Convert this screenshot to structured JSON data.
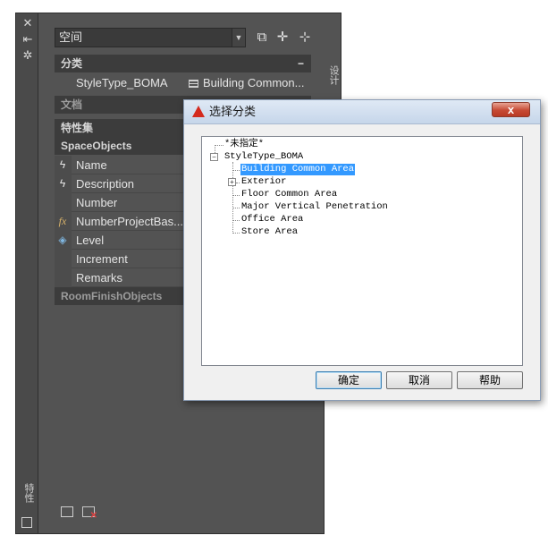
{
  "strip": {
    "label": "特性",
    "buttons": [
      "close-icon",
      "auto-hide-icon",
      "properties-menu-icon"
    ]
  },
  "palette": {
    "right_tab_label": "设计",
    "style_select_value": "空间",
    "sections": {
      "classification": {
        "title": "分类",
        "collapse_glyph": "−",
        "row_label": "StyleType_BOMA",
        "row_value": "Building Common..."
      },
      "document_title": "文档",
      "property_sets_title": "特性集",
      "space_objects_title": "SpaceObjects",
      "room_finish_title": "RoomFinishObjects"
    },
    "properties": [
      {
        "label": "Name",
        "icon": "lightning-icon"
      },
      {
        "label": "Description",
        "icon": "lightning-icon"
      },
      {
        "label": "Number",
        "icon": ""
      },
      {
        "label": "NumberProjectBas...",
        "icon": "formula-icon"
      },
      {
        "label": "Level",
        "icon": "level-icon"
      },
      {
        "label": "Increment",
        "icon": ""
      },
      {
        "label": "Remarks",
        "icon": ""
      }
    ]
  },
  "dialog": {
    "title": "选择分类",
    "close_glyph": "x",
    "tree": {
      "unspecified": "*未指定*",
      "root": "StyleType_BOMA",
      "children": [
        "Building Common Area",
        "Exterior",
        "Floor Common Area",
        "Major Vertical Penetration",
        "Office Area",
        "Store Area"
      ],
      "selected": "Building Common Area"
    },
    "buttons": {
      "ok": "确定",
      "cancel": "取消",
      "help": "帮助"
    }
  },
  "colors": {
    "palette_bg": "#535353",
    "header_bg": "#3c3c3c",
    "selection": "#3399ff",
    "autocad_red": "#d42a1e"
  }
}
